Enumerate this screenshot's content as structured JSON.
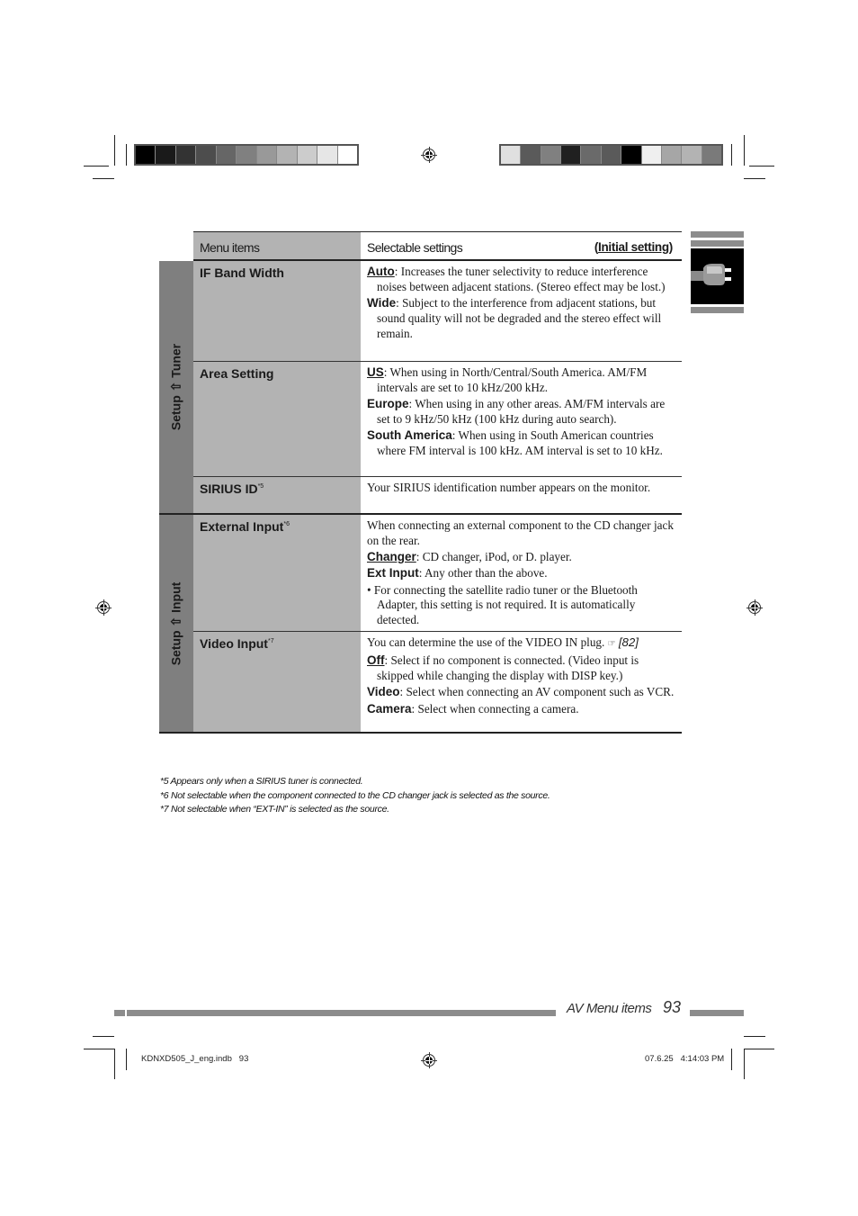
{
  "print_marks": {
    "left_swatches": [
      "#000000",
      "#1a1a1a",
      "#333333",
      "#4d4d4d",
      "#666666",
      "#808080",
      "#999999",
      "#b3b3b3",
      "#cccccc",
      "#e6e6e6",
      "#ffffff"
    ],
    "right_swatches": [
      "#e0e0e0",
      "#5a5a5a",
      "#808080",
      "#202020",
      "#6a6a6a",
      "#5a5a5a",
      "#000000",
      "#efefef",
      "#a6a6a6",
      "#b3b3b3",
      "#7a7a7a"
    ]
  },
  "side_tab": {
    "icon": "plug-icon"
  },
  "table": {
    "header": {
      "menu_items": "Menu items",
      "selectable_settings": "Selectable settings",
      "initial_setting": "Initial setting"
    },
    "groups": [
      {
        "label": "Setup ⇧ Tuner",
        "rows": [
          {
            "item": "IF Band Width",
            "footnote": "",
            "intro": "",
            "options": [
              {
                "key": "Auto",
                "initial": true,
                "text": ": Increases the tuner selectivity to reduce interference noises between adjacent stations. (Stereo effect may be lost.)"
              },
              {
                "key": "Wide",
                "initial": false,
                "text": ": Subject to the interference from adjacent stations, but sound quality will not be degraded and the stereo effect will remain."
              }
            ]
          },
          {
            "item": "Area Setting",
            "footnote": "",
            "intro": "",
            "options": [
              {
                "key": "US",
                "initial": true,
                "text": ": When using in North/Central/South America. AM/FM intervals are set to 10 kHz/200 kHz."
              },
              {
                "key": "Europe",
                "initial": false,
                "text": ": When using in any other areas. AM/FM intervals are set to 9 kHz/50 kHz (100 kHz during auto search)."
              },
              {
                "key": "South America",
                "initial": false,
                "text": ": When using in South American countries where FM interval is 100 kHz. AM interval is set to 10 kHz."
              }
            ]
          },
          {
            "item": "SIRIUS ID",
            "footnote": "*5",
            "intro": "Your SIRIUS identification number appears on the monitor.",
            "options": []
          }
        ]
      },
      {
        "label": "Setup ⇧ Input",
        "rows": [
          {
            "item": "External Input",
            "footnote": "*6",
            "intro": "When connecting an external component to the CD changer jack on the rear.",
            "options": [
              {
                "key": "Changer",
                "initial": true,
                "text": ": CD changer, iPod, or D. player."
              },
              {
                "key": "Ext Input",
                "initial": false,
                "text": ": Any other than the above."
              }
            ],
            "bullet": "For connecting the satellite radio tuner or the Bluetooth Adapter, this setting is not required. It is automatically detected."
          },
          {
            "item": "Video Input",
            "footnote": "*7",
            "intro": "You can determine the use of the VIDEO IN plug.",
            "ref": "[82]",
            "options": [
              {
                "key": "Off",
                "initial": true,
                "text": ": Select if no component is connected. (Video input is skipped while changing the display with DISP key.)"
              },
              {
                "key": "Video",
                "initial": false,
                "text": ": Select when connecting an AV component such as VCR."
              },
              {
                "key": "Camera",
                "initial": false,
                "text": ": Select when connecting a camera."
              }
            ]
          }
        ]
      }
    ]
  },
  "footnotes": [
    "*5 Appears only when a SIRIUS tuner is connected.",
    "*6 Not selectable when the component connected to the CD changer jack is selected as the source.",
    "*7 Not selectable when “EXT-IN” is selected as the source."
  ],
  "footer": {
    "section": "AV Menu items",
    "page": "93",
    "slug_file": "KDNXD505_J_eng.indb   93",
    "slug_date": "07.6.25   4:14:03 PM"
  }
}
